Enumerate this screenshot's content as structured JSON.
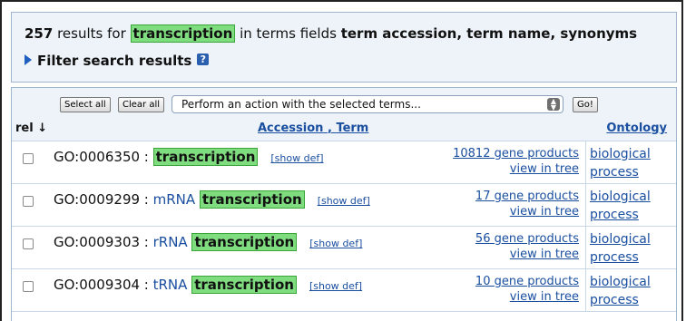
{
  "summary": {
    "count": "257",
    "results_for": "results for",
    "query": "transcription",
    "in_fields": "in terms fields",
    "fields": "term accession, term name, synonyms"
  },
  "filter": {
    "label": "Filter search results",
    "help_icon": "?"
  },
  "actions": {
    "select_all": "Select all",
    "clear_all": "Clear all",
    "action_select": "Perform an action with the selected terms...",
    "go": "Go!"
  },
  "columns": {
    "rel": "rel ↓",
    "accession": "Accession",
    "term_sep": ",",
    "term": "Term",
    "ontology": "Ontology"
  },
  "rows": [
    {
      "accession": "GO:0006350",
      "sep": " : ",
      "prefix": "",
      "match": "transcription",
      "show_def": "[show def]",
      "gene_products": "10812 gene products",
      "view_tree": "view in tree",
      "ontology1": "biological",
      "ontology2": "process"
    },
    {
      "accession": "GO:0009299",
      "sep": " : ",
      "prefix": "mRNA ",
      "match": "transcription",
      "show_def": "[show def]",
      "gene_products": "17 gene products",
      "view_tree": "view in tree",
      "ontology1": "biological",
      "ontology2": "process"
    },
    {
      "accession": "GO:0009303",
      "sep": " : ",
      "prefix": "rRNA ",
      "match": "transcription",
      "show_def": "[show def]",
      "gene_products": "56 gene products",
      "view_tree": "view in tree",
      "ontology1": "biological",
      "ontology2": "process"
    },
    {
      "accession": "GO:0009304",
      "sep": " : ",
      "prefix": "tRNA ",
      "match": "transcription",
      "show_def": "[show def]",
      "gene_products": "10 gene products",
      "view_tree": "view in tree",
      "ontology1": "biological",
      "ontology2": "process"
    }
  ],
  "colors": {
    "highlight": "#7fdc7f",
    "link": "#1a4fa0",
    "panel": "#edf3f9"
  }
}
